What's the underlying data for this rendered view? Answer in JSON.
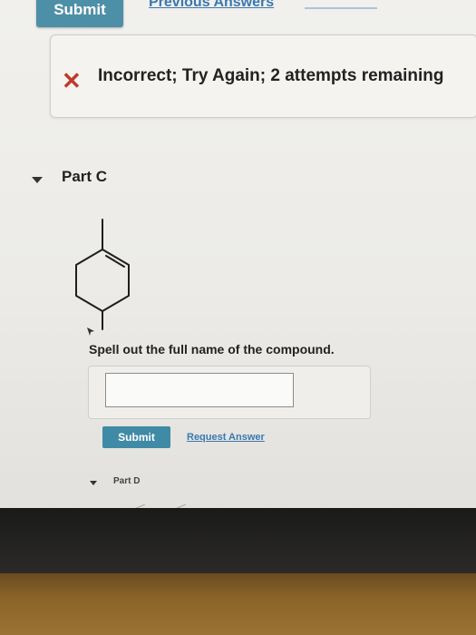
{
  "top_bar": {
    "submit_label": "Submit",
    "previous_answers_label": "Previous Answers"
  },
  "feedback": {
    "message": "Incorrect; Try Again; 2 attempts remaining",
    "icon": "x-icon",
    "icon_color": "#c0392b"
  },
  "part_c": {
    "label": "Part C",
    "instruction": "Spell out the full name of the compound.",
    "answer_value": "",
    "submit_label": "Submit",
    "request_answer_label": "Request Answer"
  },
  "part_d": {
    "label": "Part D"
  },
  "colors": {
    "button": "#3f8aa5",
    "link": "#3b78b0",
    "error": "#c0392b"
  }
}
